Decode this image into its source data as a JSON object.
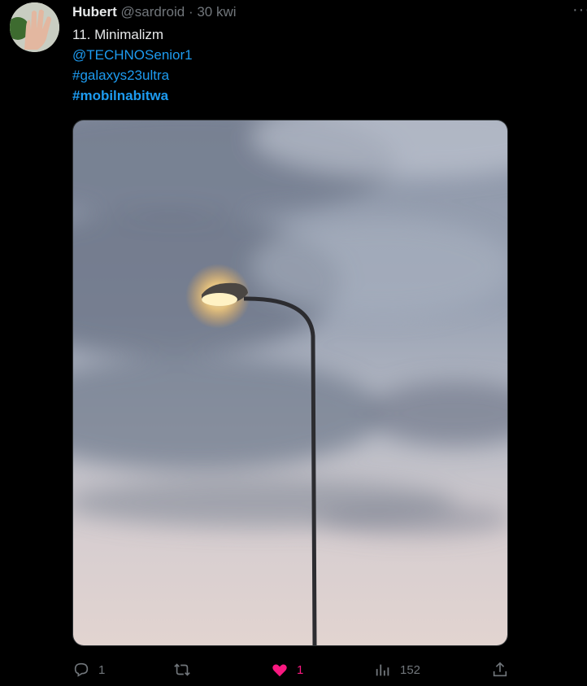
{
  "tweet": {
    "author_name": "Hubert",
    "handle": "@sardroid",
    "separator": "·",
    "time": "30 kwi",
    "text_line1": "11. Minimalizm",
    "mention": "@TECHNOSenior1",
    "hashtag1": "#galaxys23ultra",
    "hashtag2": "#mobilnabitwa",
    "more_label": "···"
  },
  "actions": {
    "replies": "1",
    "likes": "1",
    "views": "152"
  },
  "colors": {
    "background": "#000000",
    "link": "#1d9bf0",
    "muted": "#71767b",
    "like": "#f91880"
  },
  "icons": [
    "reply-icon",
    "retweet-icon",
    "like-icon",
    "views-icon",
    "share-icon"
  ]
}
